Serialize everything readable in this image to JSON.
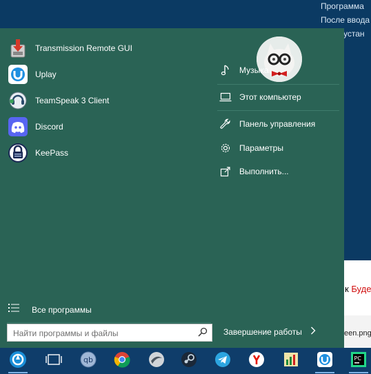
{
  "background": {
    "lines": [
      "Программа",
      "После ввода",
      "е устан"
    ],
    "lower_prefix": "к ",
    "lower_accent": "Буде",
    "file_text": "een.png"
  },
  "start_menu": {
    "pinned": [
      {
        "label": "Transmission Remote GUI",
        "icon": "transmission-icon"
      },
      {
        "label": "Uplay",
        "icon": "uplay-icon"
      },
      {
        "label": "TeamSpeak 3 Client",
        "icon": "teamspeak-icon"
      },
      {
        "label": "Discord",
        "icon": "discord-icon"
      },
      {
        "label": "KeePass",
        "icon": "keepass-icon"
      }
    ],
    "links": [
      {
        "label": "Музыка",
        "icon": "music-icon"
      },
      {
        "label": "Этот компьютер",
        "icon": "computer-icon"
      },
      {
        "label": "Панель управления",
        "icon": "wrench-icon"
      },
      {
        "label": "Параметры",
        "icon": "gear-icon"
      },
      {
        "label": "Выполнить...",
        "icon": "run-icon"
      }
    ],
    "all_programs": "Все программы",
    "search": {
      "placeholder": "Найти программы и файлы",
      "value": ""
    },
    "shutdown": "Завершение работы"
  },
  "taskbar": {
    "items": [
      "start-button-icon",
      "task-view-icon",
      "qbittorrent-icon",
      "chrome-icon",
      "app-icon",
      "steam-icon",
      "telegram-icon",
      "yandex-browser-icon",
      "chart-app-icon",
      "uplay-icon",
      "pycharm-icon"
    ]
  },
  "colors": {
    "menu_bg": "#2a6355",
    "taskbar_bg": "#0f3d6a",
    "desktop_bg": "#0b3a63"
  }
}
